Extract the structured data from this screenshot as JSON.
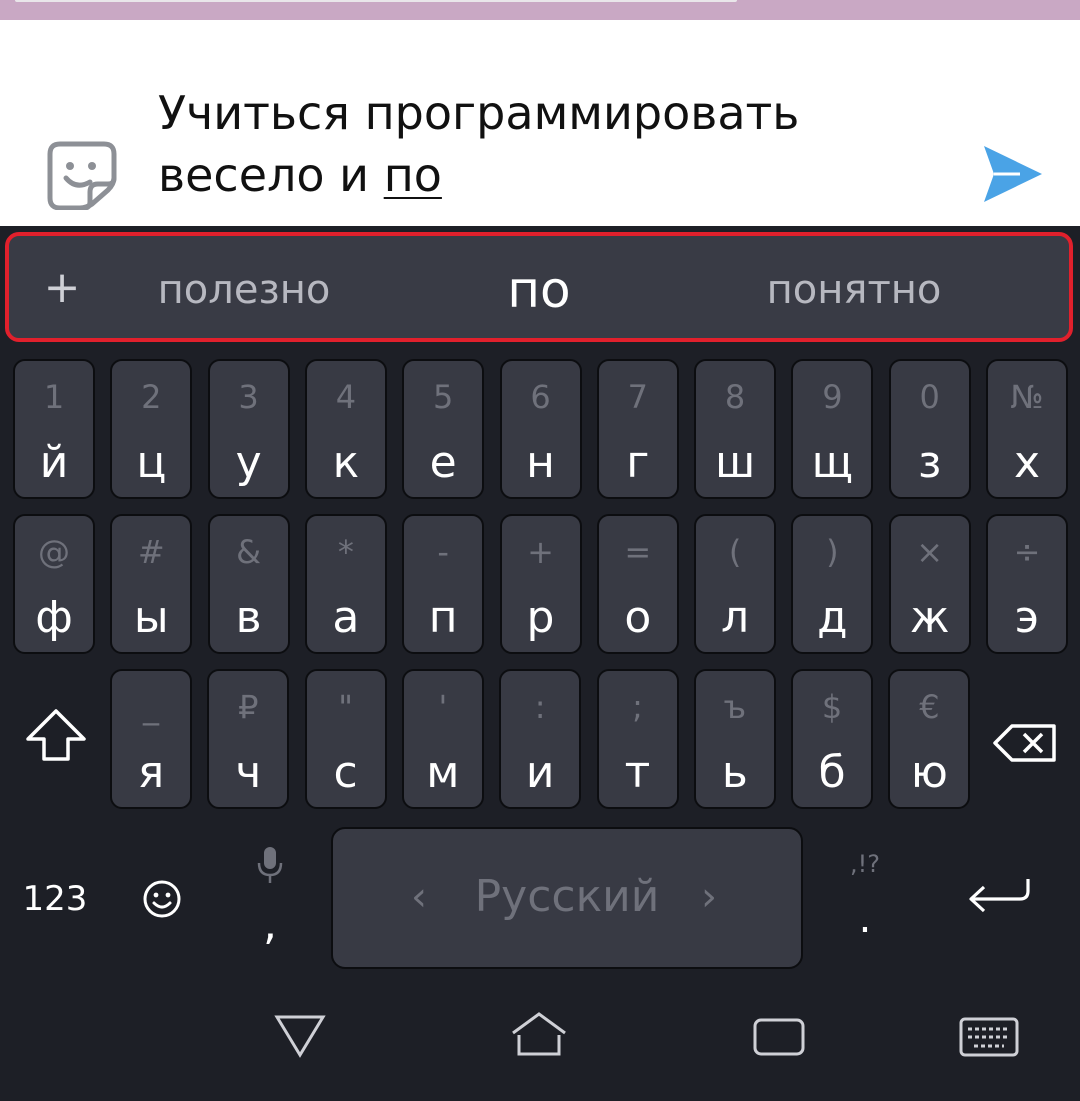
{
  "compose": {
    "text_before": "Учиться программировать\nвесело и ",
    "current_word": "по"
  },
  "suggestions": {
    "plus_label": "+",
    "items": [
      "полезно",
      "по",
      "понятно"
    ]
  },
  "keyboard": {
    "row1": [
      {
        "alt": "1",
        "main": "й"
      },
      {
        "alt": "2",
        "main": "ц"
      },
      {
        "alt": "3",
        "main": "у"
      },
      {
        "alt": "4",
        "main": "к"
      },
      {
        "alt": "5",
        "main": "е"
      },
      {
        "alt": "6",
        "main": "н"
      },
      {
        "alt": "7",
        "main": "г"
      },
      {
        "alt": "8",
        "main": "ш"
      },
      {
        "alt": "9",
        "main": "щ"
      },
      {
        "alt": "0",
        "main": "з"
      },
      {
        "alt": "№",
        "main": "х"
      }
    ],
    "row2": [
      {
        "alt": "@",
        "main": "ф"
      },
      {
        "alt": "#",
        "main": "ы"
      },
      {
        "alt": "&",
        "main": "в"
      },
      {
        "alt": "*",
        "main": "а"
      },
      {
        "alt": "-",
        "main": "п"
      },
      {
        "alt": "+",
        "main": "р"
      },
      {
        "alt": "=",
        "main": "о"
      },
      {
        "alt": "(",
        "main": "л"
      },
      {
        "alt": ")",
        "main": "д"
      },
      {
        "alt": "×",
        "main": "ж"
      },
      {
        "alt": "÷",
        "main": "э"
      }
    ],
    "row3": [
      {
        "alt": "_",
        "main": "я"
      },
      {
        "alt": "₽",
        "main": "ч"
      },
      {
        "alt": "\"",
        "main": "с"
      },
      {
        "alt": "'",
        "main": "м"
      },
      {
        "alt": ":",
        "main": "и"
      },
      {
        "alt": ";",
        "main": "т"
      },
      {
        "alt": "ъ",
        "main": "ь"
      },
      {
        "alt": "$",
        "main": "б"
      },
      {
        "alt": "€",
        "main": "ю"
      }
    ],
    "numbers_label": "123",
    "comma_label": ",",
    "period_label": ".",
    "punct_alt": ",!?",
    "space_label": "Русский",
    "lang_left": "‹",
    "lang_right": "›"
  },
  "icons": {
    "sticker": "sticker-icon",
    "send": "send-icon",
    "shift": "shift-icon",
    "backspace": "backspace-icon",
    "emoji": "emoji-icon",
    "mic": "mic-icon",
    "enter": "enter-icon",
    "nav_back": "back-triangle-icon",
    "nav_home": "home-icon",
    "nav_recents": "recents-icon",
    "nav_keyboard": "keyboard-hide-icon"
  },
  "colors": {
    "accent_send": "#4aa3e6",
    "suggestion_highlight_border": "#e1202c",
    "key_background": "#383a44"
  }
}
